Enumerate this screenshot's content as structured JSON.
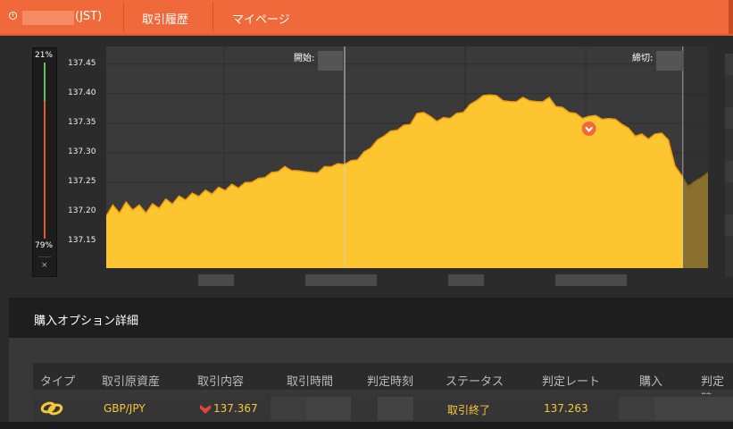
{
  "topbar": {
    "timezone_label": "(JST)",
    "tabs": [
      {
        "label": "取引履歴"
      },
      {
        "label": "マイページ"
      }
    ]
  },
  "gauge": {
    "top_percent": "21%",
    "bottom_percent": "79%",
    "close_symbol": "×",
    "green_fraction": 0.21
  },
  "chart": {
    "start_label": "開始:",
    "end_label": "締切:",
    "colors": {
      "area": "#fdc52f",
      "edge": "#f29a0d",
      "background": "#3a3a3a",
      "grid": "#2e2e2e",
      "marker": "#f0693a"
    }
  },
  "chart_data": {
    "type": "area",
    "title": "",
    "xlabel": "",
    "ylabel": "",
    "ylim": [
      137.105,
      137.48
    ],
    "y_ticks": [
      "137.45",
      "137.40",
      "137.35",
      "137.30",
      "137.25",
      "137.20",
      "137.15"
    ],
    "series": [
      {
        "values": [
          137.195,
          137.21,
          137.2,
          137.215,
          137.205,
          137.21,
          137.2,
          137.212,
          137.208,
          137.22,
          137.215,
          137.225,
          137.222,
          137.23,
          137.228,
          137.235,
          137.232,
          137.24,
          137.238,
          137.245,
          137.242,
          137.248,
          137.252,
          137.255,
          137.26,
          137.265,
          137.27,
          137.275,
          137.272,
          137.268,
          137.27,
          137.265,
          137.268,
          137.275,
          137.278,
          137.28,
          137.282,
          137.285,
          137.29,
          137.3,
          137.31,
          137.32,
          137.33,
          137.335,
          137.34,
          137.345,
          137.35,
          137.365,
          137.37,
          137.36,
          137.355,
          137.358,
          137.36,
          137.365,
          137.37,
          137.38,
          137.39,
          137.395,
          137.4,
          137.395,
          137.39,
          137.385,
          137.388,
          137.392,
          137.39,
          137.385,
          137.388,
          137.392,
          137.38,
          137.375,
          137.37,
          137.365,
          137.36,
          137.36,
          137.365,
          137.355,
          137.36,
          137.355,
          137.35,
          137.34,
          137.33,
          137.33,
          137.325,
          137.33,
          137.335,
          137.32,
          137.28,
          137.26,
          137.245,
          137.25,
          137.26,
          137.265
        ],
        "marker_value": 137.341,
        "marker_index": 73
      }
    ]
  },
  "panel": {
    "title": "購入オプション詳細",
    "columns": [
      "タイプ",
      "取引原資産",
      "取引内容",
      "取引時間",
      "判定時刻",
      "ステータス",
      "判定レート",
      "購入",
      "判定時"
    ],
    "row": {
      "asset": "GBP/JPY",
      "trade_content": "137.367",
      "status": "取引終了",
      "rate": "137.263"
    }
  }
}
